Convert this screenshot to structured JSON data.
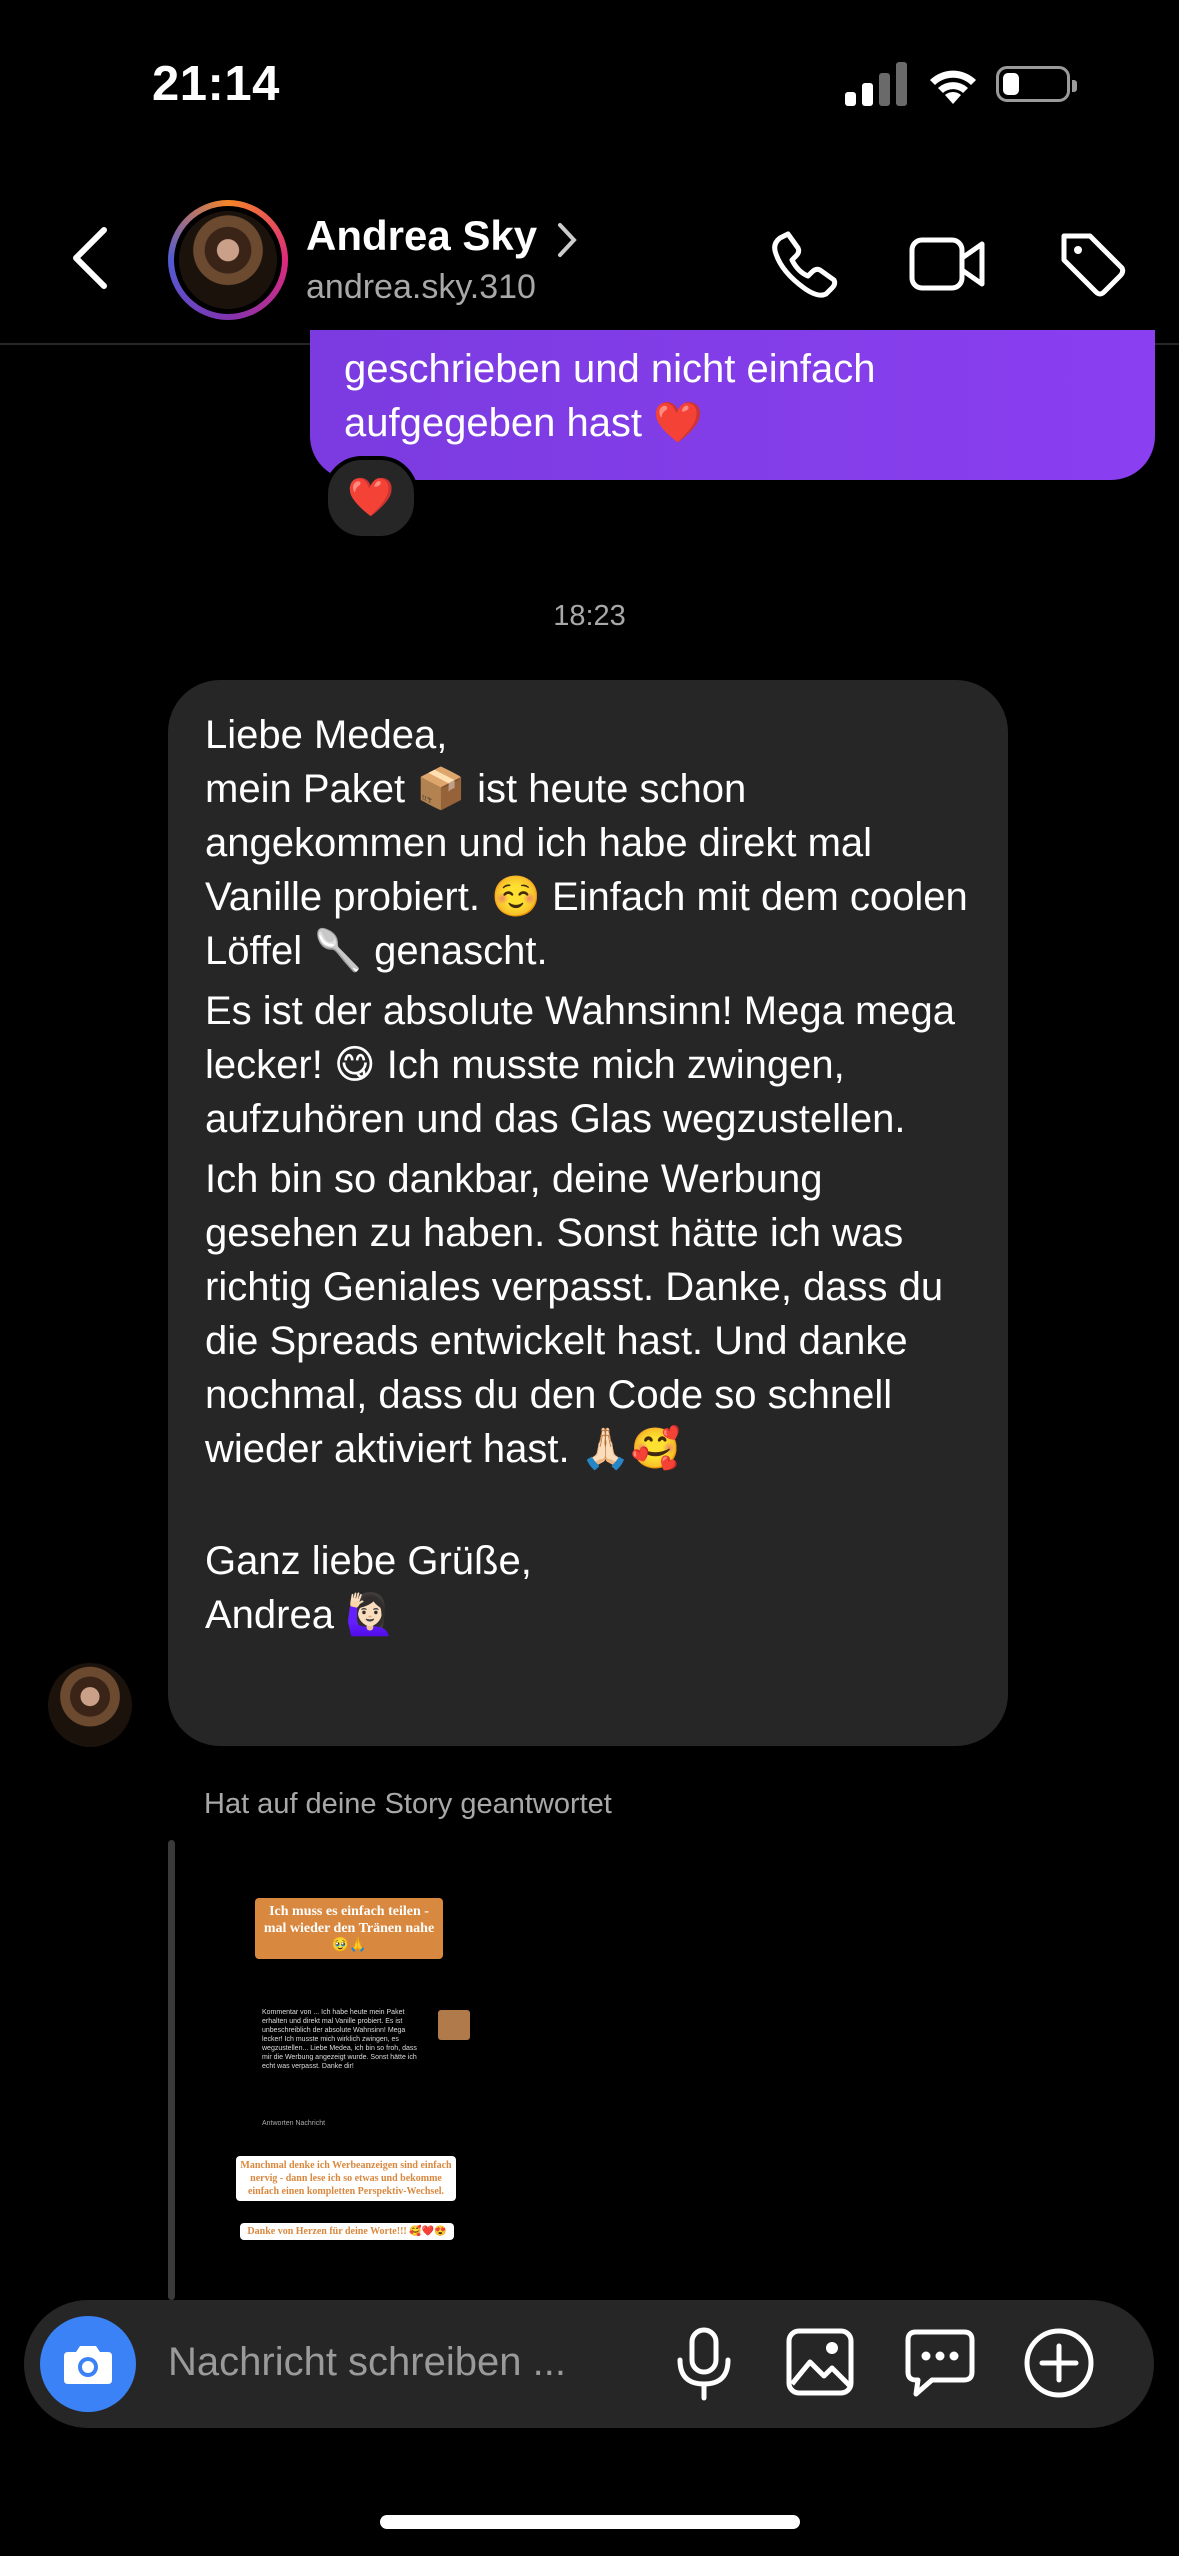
{
  "status": {
    "time": "21:14"
  },
  "header": {
    "name": "Andrea Sky",
    "handle": "andrea.sky.310"
  },
  "outgoing": {
    "line1": "geschrieben und nicht einfach",
    "line2": "aufgegeben hast ❤️",
    "reaction": "❤️"
  },
  "timestamp": "18:23",
  "incoming": {
    "p1": "Liebe Medea,\nmein Paket 📦 ist heute schon angekommen und ich habe direkt mal Vanille probiert. ☺️ Einfach mit dem coolen Löffel 🥄 genascht.",
    "p2": "Es ist der absolute Wahnsinn! Mega mega lecker! 😋 Ich musste mich zwingen, aufzuhören und das Glas wegzustellen.",
    "p3": "Ich bin so dankbar, deine Werbung gesehen zu haben. Sonst hätte ich was richtig Geniales verpasst. Danke, dass du die Spreads entwickelt hast. Und danke nochmal, dass du den Code so schnell wieder aktiviert hast. 🙏🏻🥰",
    "p4": "Ganz liebe Grüße,\nAndrea 🙋🏻‍♀️"
  },
  "story": {
    "label": "Hat auf deine Story geantwortet",
    "sticker1": "Ich muss es einfach teilen - mal wieder den Tränen nahe 🥹🙏",
    "sticker2": "Manchmal denke ich Werbeanzeigen sind einfach nervig - dann lese ich so etwas und bekomme einfach einen kompletten Perspektiv-Wechsel.",
    "sticker3": "Danke von Herzen für deine Worte!!! 🥰❤️😍",
    "mini_text": "Kommentar von ... Ich habe heute mein Paket erhalten und direkt mal Vanille probiert. Es ist unbeschreiblich der absolute Wahnsinn! Mega lecker! Ich musste mich wirklich zwingen, es wegzustellen... Liebe Medea, ich bin so froh, dass mir die Werbung angezeigt wurde. Sonst hätte ich echt was verpasst. Danke dir!",
    "mini_actions": "Antworten   Nachricht"
  },
  "composer": {
    "placeholder": "Nachricht schreiben ..."
  }
}
